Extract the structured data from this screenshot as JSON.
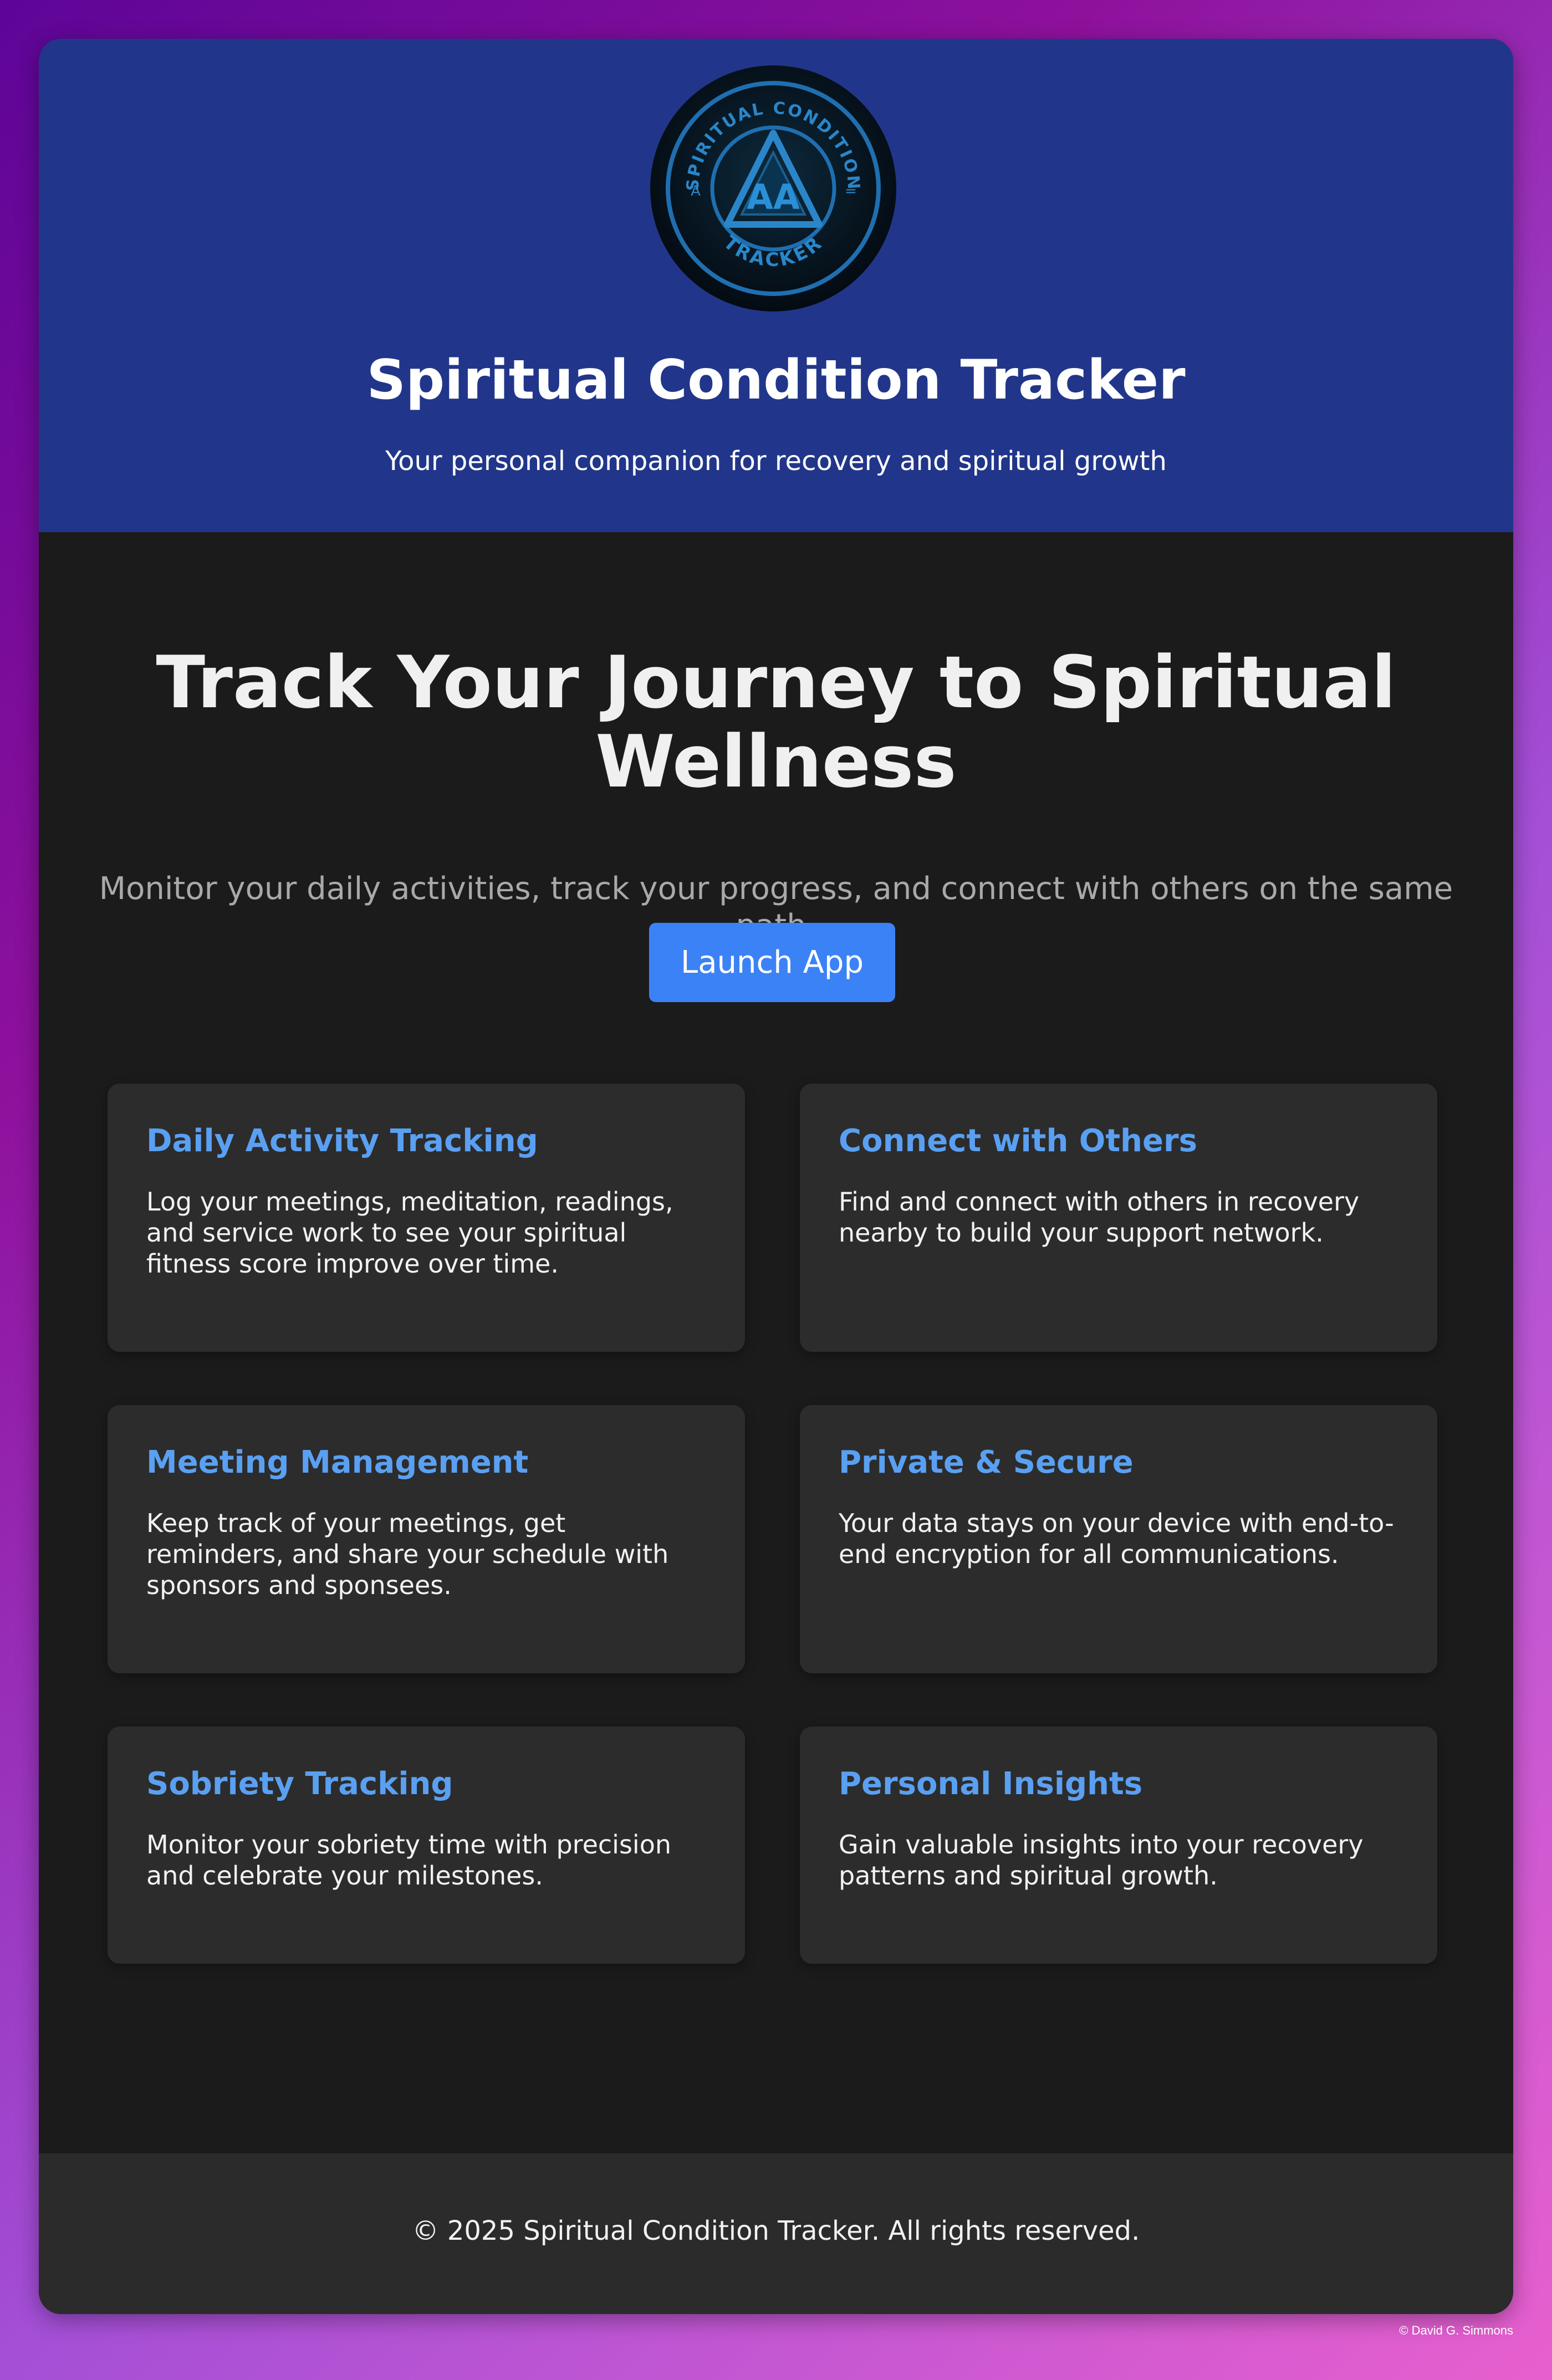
{
  "header": {
    "logo_text_top": "SPIRITUAL CONDITION",
    "logo_text_bottom": "TRACKER",
    "logo_monogram": "AA",
    "logo_side_left": "A",
    "logo_side_right": "=",
    "title": "Spiritual Condition Tracker",
    "tagline": "Your personal companion for recovery and spiritual growth"
  },
  "hero": {
    "title": "Track Your Journey to Spiritual Wellness",
    "subtitle": "Monitor your daily activities, track your progress, and connect with others on the same path.",
    "cta_label": "Launch App"
  },
  "features": [
    {
      "title": "Daily Activity Tracking",
      "description": "Log your meetings, meditation, readings, and service work to see your spiritual fitness score improve over time."
    },
    {
      "title": "Connect with Others",
      "description": "Find and connect with others in recovery nearby to build your support network."
    },
    {
      "title": "Meeting Management",
      "description": "Keep track of your meetings, get reminders, and share your schedule with sponsors and sponsees."
    },
    {
      "title": "Private & Secure",
      "description": "Your data stays on your device with end-to-end encryption for all communications."
    },
    {
      "title": "Sobriety Tracking",
      "description": "Monitor your sobriety time with precision and celebrate your milestones."
    },
    {
      "title": "Personal Insights",
      "description": "Gain valuable insights into your recovery patterns and spiritual growth."
    }
  ],
  "footer": {
    "copyright": "© 2025 Spiritual Condition Tracker. All rights reserved."
  },
  "credit": "© David G. Simmons",
  "colors": {
    "header_bg": "#21368a",
    "accent": "#3b82f6",
    "feature_title": "#5aa0f2",
    "card_bg": "#2c2c2c",
    "page_bg": "#1b1b1b"
  }
}
